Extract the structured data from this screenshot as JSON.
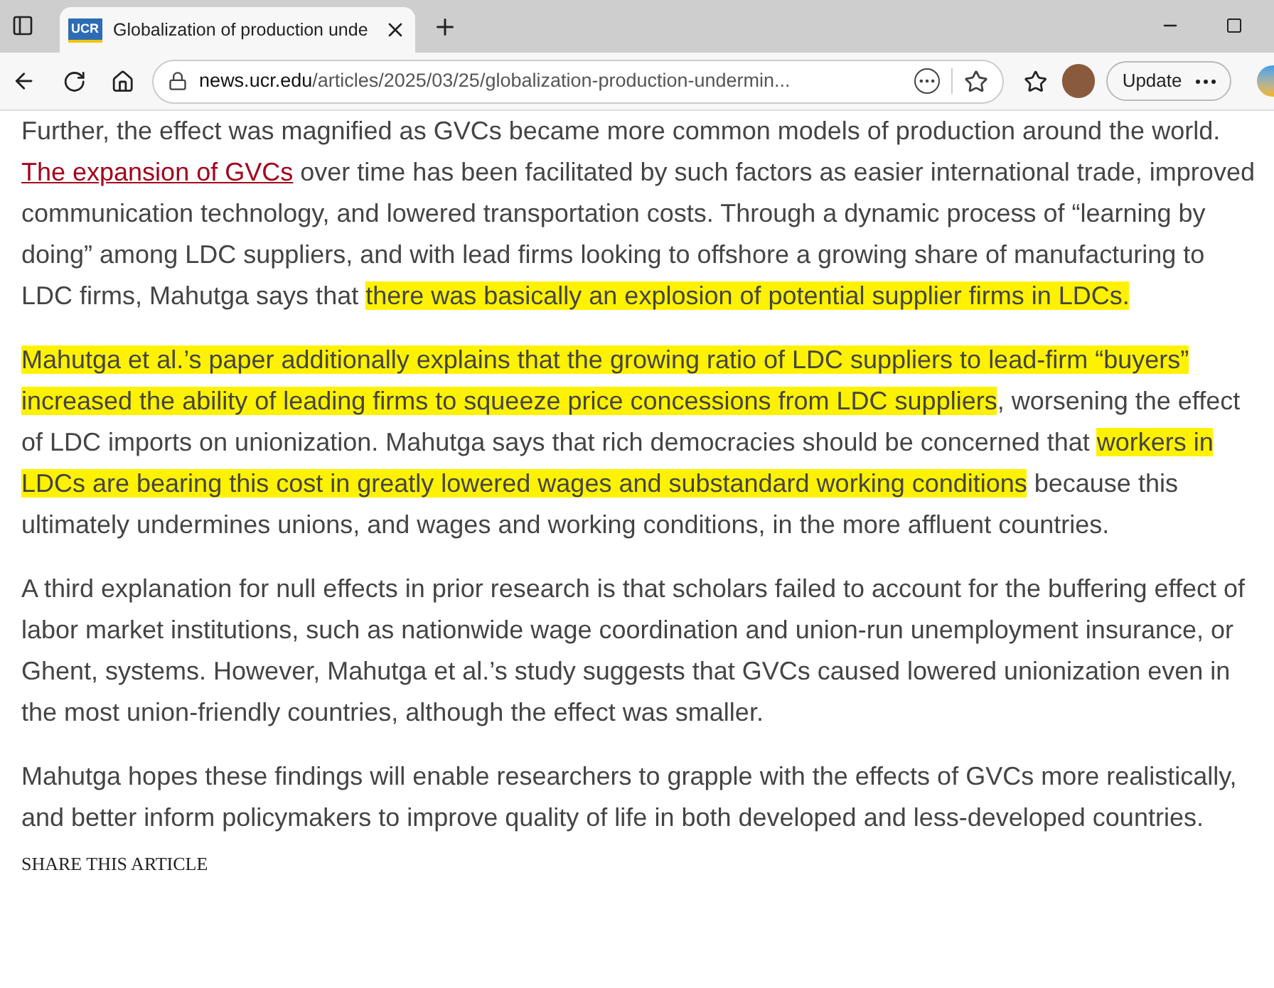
{
  "tabs": [
    {
      "favicon": "UCR",
      "title": "Globalization of production unde",
      "selected": true
    }
  ],
  "address_bar": {
    "host": "news.ucr.edu",
    "path": "/articles/2025/03/25/globalization-production-undermin..."
  },
  "toolbar": {
    "update_button": "Update"
  },
  "article": {
    "paragraphs": [
      {
        "segments": [
          {
            "kind": "text",
            "text": "Further, the effect was magnified as GVCs became more common models of production around the world. ",
            "highlighted": false
          },
          {
            "kind": "link",
            "text": "The expansion of GVCs",
            "highlighted": false
          },
          {
            "kind": "text",
            "text": " over time has been facilitated by such factors as easier international trade, improved communication technology, and lowered transportation costs. Through a dynamic process of “learning by doing” among LDC suppliers, and with lead firms looking to offshore a growing share of manufacturing to LDC firms, Mahutga says that ",
            "highlighted": false
          },
          {
            "kind": "text",
            "text": "there was basically an explosion of potential supplier firms in LDCs.",
            "highlighted": true
          }
        ]
      },
      {
        "segments": [
          {
            "kind": "text",
            "text": "Mahutga et al.’s paper additionally explains that the growing ratio of LDC suppliers to lead-firm “buyers” increased the ability of leading firms to squeeze price concessions from LDC suppliers",
            "highlighted": true
          },
          {
            "kind": "text",
            "text": ", worsening the effect of LDC imports on unionization. Mahutga says that rich democracies should be concerned that ",
            "highlighted": false
          },
          {
            "kind": "text",
            "text": "workers in LDCs are bearing this cost in greatly lowered wages and substandard working conditions",
            "highlighted": true
          },
          {
            "kind": "text",
            "text": " because this ultimately undermines unions, and wages and working conditions, in the more affluent countries.",
            "highlighted": false
          }
        ]
      },
      {
        "segments": [
          {
            "kind": "text",
            "text": "A third explanation for null effects in prior research is that scholars failed to account for the buffering effect of labor market institutions, such as nationwide wage coordination and union-run unemployment insurance, or Ghent, systems. However, Mahutga et al.’s study suggests that GVCs caused lowered unionization even in the most union-friendly countries, although the effect was smaller.",
            "highlighted": false
          }
        ]
      },
      {
        "segments": [
          {
            "kind": "text",
            "text": "Mahutga hopes these findings will enable researchers to grapple with the effects of GVCs more realistically, and better inform policymakers to improve quality of life in both developed and less-developed countries.",
            "highlighted": false
          }
        ]
      }
    ],
    "share_heading": "SHARE THIS ARTICLE"
  }
}
